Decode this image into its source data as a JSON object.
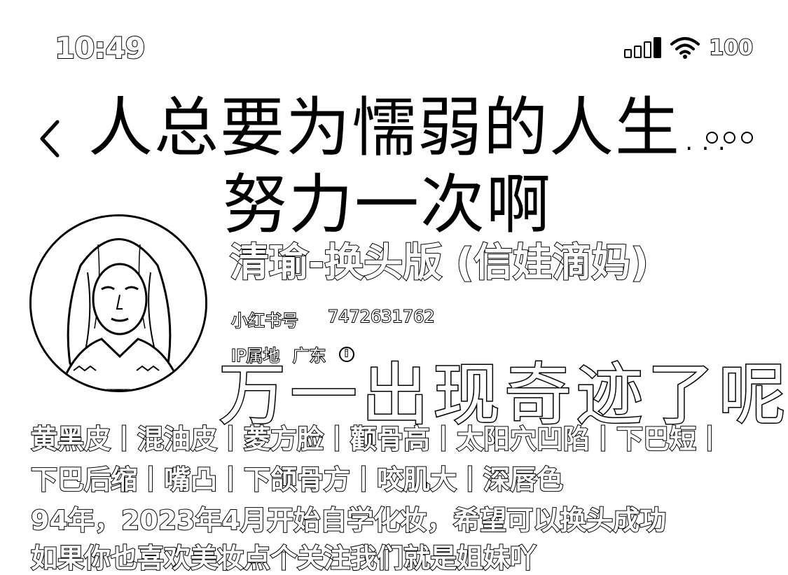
{
  "status_bar": {
    "time": "10:49",
    "battery": "100"
  },
  "header": {
    "title_line1": "人总要为懦弱的人生",
    "title_ellipsis": "…",
    "title_line2": "努力一次啊"
  },
  "profile": {
    "nickname": "清瑜-换头版 (信娃滴妈)",
    "id_label": "小红书号",
    "id_value": "7472631762",
    "ip_label": "IP属地",
    "ip_value": "广东",
    "info_icon_glyph": "i"
  },
  "overlay_caption": "万一出现奇迹了呢",
  "bio": {
    "line1": "黄黑皮丨混油皮丨菱方脸丨颧骨高丨太阳穴凹陷丨下巴短丨",
    "line2": "下巴后缩丨嘴凸丨下颌骨方丨咬肌大丨深唇色",
    "line3": "94年，2023年4月开始自学化妆，希望可以换头成功",
    "line4": "如果你也喜欢美妆点个关注我们就是姐妹吖"
  },
  "icons": {
    "back": "chevron-left-icon",
    "more": "more-horizontal-icon",
    "signal": "cellular-signal-icon",
    "wifi": "wifi-icon",
    "info": "info-icon"
  }
}
